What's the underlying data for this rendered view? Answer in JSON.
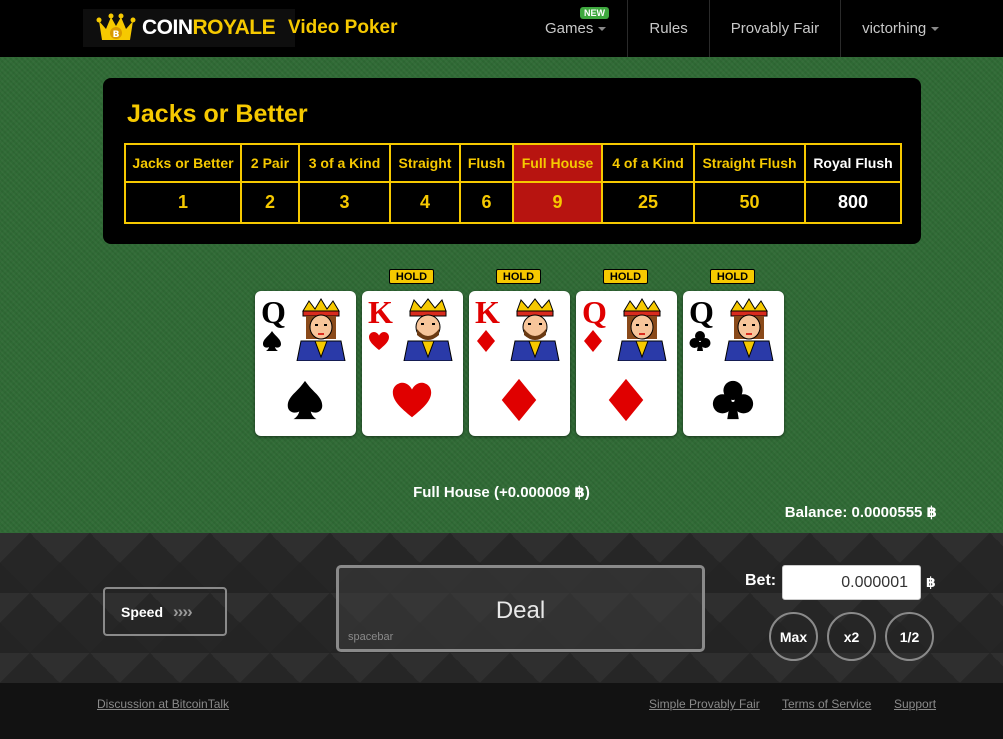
{
  "nav": {
    "brand_coin": "COIN",
    "brand_royale": "ROYALE",
    "brand_sub": "Video Poker",
    "games": "Games",
    "new_badge": "NEW",
    "rules": "Rules",
    "provably_fair": "Provably Fair",
    "user": "victorhing"
  },
  "paytable": {
    "title": "Jacks or Better",
    "hands": [
      "Jacks or Better",
      "2 Pair",
      "3 of a Kind",
      "Straight",
      "Flush",
      "Full House",
      "4 of a Kind",
      "Straight Flush",
      "Royal Flush"
    ],
    "payouts": [
      "1",
      "2",
      "3",
      "4",
      "6",
      "9",
      "25",
      "50",
      "800"
    ],
    "highlighted": "Full House"
  },
  "cards": [
    {
      "rank": "Q",
      "suit": "spades",
      "color": "black",
      "held": false
    },
    {
      "rank": "K",
      "suit": "hearts",
      "color": "red",
      "held": true
    },
    {
      "rank": "K",
      "suit": "diamonds",
      "color": "red",
      "held": true
    },
    {
      "rank": "Q",
      "suit": "diamonds",
      "color": "red",
      "held": true
    },
    {
      "rank": "Q",
      "suit": "clubs",
      "color": "black",
      "held": true
    }
  ],
  "hold_label": "HOLD",
  "result_text": "Full House (+0.000009 ฿)",
  "balance_text": "Balance: 0.0000555 ฿",
  "controls": {
    "speed_label": "Speed",
    "speed_arrows": "››››",
    "deal_label": "Deal",
    "deal_hint": "spacebar",
    "bet_label": "Bet:",
    "bet_value": "0.000001",
    "bet_currency": "฿",
    "max_label": "Max",
    "x2_label": "x2",
    "half_label": "1/2"
  },
  "footer": {
    "discussion": "Discussion at BitcoinTalk",
    "simple_fair": "Simple Provably Fair",
    "terms": "Terms of Service",
    "support": "Support"
  },
  "colors": {
    "gold": "#f6c900",
    "felt": "#2f6a35",
    "highlight": "#b71410",
    "card_red": "#e00000"
  }
}
